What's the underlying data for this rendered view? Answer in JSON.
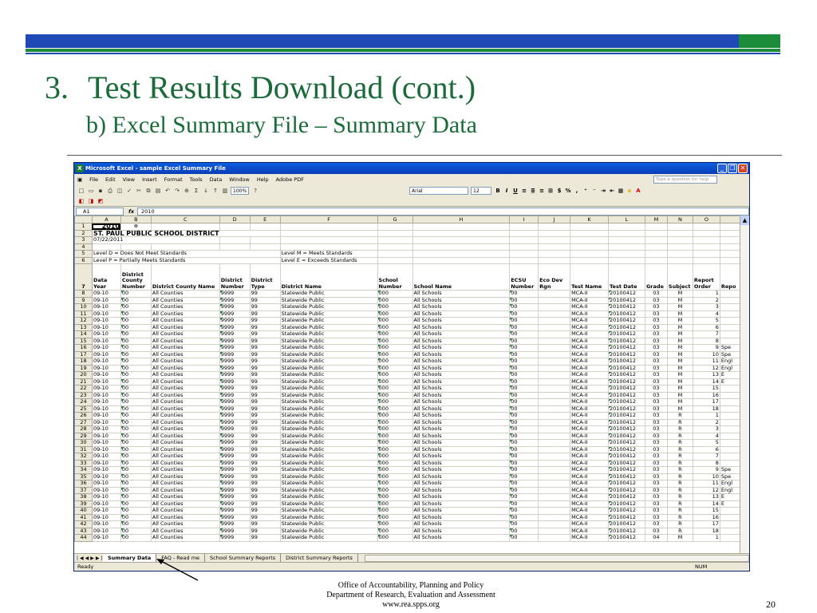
{
  "slide": {
    "number": "3.",
    "title": "Test Results Download (cont.)",
    "subtitle": "b) Excel Summary File – Summary Data",
    "footer_lines": [
      "Office of Accountability, Planning and Policy",
      "Department of Research, Evaluation and Assessment",
      "www.rea.spps.org"
    ],
    "page_number": "20",
    "colors": {
      "title": "#1b6b3a",
      "bar_blue": "#1f49b5",
      "bar_green": "#1d8c3a"
    }
  },
  "excel": {
    "window_title": "Microsoft Excel - sample Excel Summary File",
    "app_icon": "excel-icon",
    "menu": [
      "File",
      "Edit",
      "View",
      "Insert",
      "Format",
      "Tools",
      "Data",
      "Window",
      "Help",
      "Adobe PDF"
    ],
    "help_placeholder": "Type a question for help",
    "font_name": "Arial",
    "font_size": "12",
    "zoom": "100%",
    "name_box": "A1",
    "formula_value": "2010",
    "column_letters": [
      "A",
      "B",
      "C",
      "D",
      "E",
      "F",
      "G",
      "H",
      "I",
      "J",
      "K",
      "L",
      "M",
      "N",
      "O",
      ""
    ],
    "a1_value": "2010",
    "title_row": "ST. PAUL PUBLIC SCHOOL DISTRICT",
    "date_row": "07/22/2011",
    "legend": {
      "d": "Level D = Does Not Meet Standards",
      "p": "Level P = Partially Meets Standards",
      "m": "Level M = Meets Standards",
      "e": "Level E = Exceeds Standards"
    },
    "headers": [
      "Data Year",
      "District County Number",
      "District County Name",
      "District Number",
      "District Type",
      "District Name",
      "School Number",
      "School Name",
      "ECSU Number",
      "Eco Dev Rgn",
      "Test Name",
      "Test Date",
      "Grade",
      "Subject",
      "Report Order",
      "Repo"
    ],
    "rows": [
      [
        "8",
        "09-10",
        "00",
        "All Counties",
        "9999",
        "99",
        "Statewide Public",
        "000",
        "All Schools",
        "00",
        "",
        "MCA-II",
        "20100412",
        "03",
        "M",
        "1",
        ""
      ],
      [
        "9",
        "09-10",
        "00",
        "All Counties",
        "9999",
        "99",
        "Statewide Public",
        "000",
        "All Schools",
        "00",
        "",
        "MCA-II",
        "20100412",
        "03",
        "M",
        "2",
        ""
      ],
      [
        "10",
        "09-10",
        "00",
        "All Counties",
        "9999",
        "99",
        "Statewide Public",
        "000",
        "All Schools",
        "00",
        "",
        "MCA-II",
        "20100412",
        "03",
        "M",
        "3",
        ""
      ],
      [
        "11",
        "09-10",
        "00",
        "All Counties",
        "9999",
        "99",
        "Statewide Public",
        "000",
        "All Schools",
        "00",
        "",
        "MCA-II",
        "20100412",
        "03",
        "M",
        "4",
        ""
      ],
      [
        "12",
        "09-10",
        "00",
        "All Counties",
        "9999",
        "99",
        "Statewide Public",
        "000",
        "All Schools",
        "00",
        "",
        "MCA-II",
        "20100412",
        "03",
        "M",
        "5",
        ""
      ],
      [
        "13",
        "09-10",
        "00",
        "All Counties",
        "9999",
        "99",
        "Statewide Public",
        "000",
        "All Schools",
        "00",
        "",
        "MCA-II",
        "20100412",
        "03",
        "M",
        "6",
        ""
      ],
      [
        "14",
        "09-10",
        "00",
        "All Counties",
        "9999",
        "99",
        "Statewide Public",
        "000",
        "All Schools",
        "00",
        "",
        "MCA-II",
        "20100412",
        "03",
        "M",
        "7",
        ""
      ],
      [
        "15",
        "09-10",
        "00",
        "All Counties",
        "9999",
        "99",
        "Statewide Public",
        "000",
        "All Schools",
        "00",
        "",
        "MCA-II",
        "20100412",
        "03",
        "M",
        "8",
        ""
      ],
      [
        "16",
        "09-10",
        "00",
        "All Counties",
        "9999",
        "99",
        "Statewide Public",
        "000",
        "All Schools",
        "00",
        "",
        "MCA-II",
        "20100412",
        "03",
        "M",
        "9",
        "Spe"
      ],
      [
        "17",
        "09-10",
        "00",
        "All Counties",
        "9999",
        "99",
        "Statewide Public",
        "000",
        "All Schools",
        "00",
        "",
        "MCA-II",
        "20100412",
        "03",
        "M",
        "10",
        "Spe"
      ],
      [
        "18",
        "09-10",
        "00",
        "All Counties",
        "9999",
        "99",
        "Statewide Public",
        "000",
        "All Schools",
        "00",
        "",
        "MCA-II",
        "20100412",
        "03",
        "M",
        "11",
        "Engl"
      ],
      [
        "19",
        "09-10",
        "00",
        "All Counties",
        "9999",
        "99",
        "Statewide Public",
        "000",
        "All Schools",
        "00",
        "",
        "MCA-II",
        "20100412",
        "03",
        "M",
        "12",
        "Engl"
      ],
      [
        "20",
        "09-10",
        "00",
        "All Counties",
        "9999",
        "99",
        "Statewide Public",
        "000",
        "All Schools",
        "00",
        "",
        "MCA-II",
        "20100412",
        "03",
        "M",
        "13",
        "E"
      ],
      [
        "21",
        "09-10",
        "00",
        "All Counties",
        "9999",
        "99",
        "Statewide Public",
        "000",
        "All Schools",
        "00",
        "",
        "MCA-II",
        "20100412",
        "03",
        "M",
        "14",
        "E"
      ],
      [
        "22",
        "09-10",
        "00",
        "All Counties",
        "9999",
        "99",
        "Statewide Public",
        "000",
        "All Schools",
        "00",
        "",
        "MCA-II",
        "20100412",
        "03",
        "M",
        "15",
        ""
      ],
      [
        "23",
        "09-10",
        "00",
        "All Counties",
        "9999",
        "99",
        "Statewide Public",
        "000",
        "All Schools",
        "00",
        "",
        "MCA-II",
        "20100412",
        "03",
        "M",
        "16",
        ""
      ],
      [
        "24",
        "09-10",
        "00",
        "All Counties",
        "9999",
        "99",
        "Statewide Public",
        "000",
        "All Schools",
        "00",
        "",
        "MCA-II",
        "20100412",
        "03",
        "M",
        "17",
        ""
      ],
      [
        "25",
        "09-10",
        "00",
        "All Counties",
        "9999",
        "99",
        "Statewide Public",
        "000",
        "All Schools",
        "00",
        "",
        "MCA-II",
        "20100412",
        "03",
        "M",
        "18",
        ""
      ],
      [
        "26",
        "09-10",
        "00",
        "All Counties",
        "9999",
        "99",
        "Statewide Public",
        "000",
        "All Schools",
        "00",
        "",
        "MCA-II",
        "20100412",
        "03",
        "R",
        "1",
        ""
      ],
      [
        "27",
        "09-10",
        "00",
        "All Counties",
        "9999",
        "99",
        "Statewide Public",
        "000",
        "All Schools",
        "00",
        "",
        "MCA-II",
        "20100412",
        "03",
        "R",
        "2",
        ""
      ],
      [
        "28",
        "09-10",
        "00",
        "All Counties",
        "9999",
        "99",
        "Statewide Public",
        "000",
        "All Schools",
        "00",
        "",
        "MCA-II",
        "20100412",
        "03",
        "R",
        "3",
        ""
      ],
      [
        "29",
        "09-10",
        "00",
        "All Counties",
        "9999",
        "99",
        "Statewide Public",
        "000",
        "All Schools",
        "00",
        "",
        "MCA-II",
        "20100412",
        "03",
        "R",
        "4",
        ""
      ],
      [
        "30",
        "09-10",
        "00",
        "All Counties",
        "9999",
        "99",
        "Statewide Public",
        "000",
        "All Schools",
        "00",
        "",
        "MCA-II",
        "20100412",
        "03",
        "R",
        "5",
        ""
      ],
      [
        "31",
        "09-10",
        "00",
        "All Counties",
        "9999",
        "99",
        "Statewide Public",
        "000",
        "All Schools",
        "00",
        "",
        "MCA-II",
        "20100412",
        "03",
        "R",
        "6",
        ""
      ],
      [
        "32",
        "09-10",
        "00",
        "All Counties",
        "9999",
        "99",
        "Statewide Public",
        "000",
        "All Schools",
        "00",
        "",
        "MCA-II",
        "20100412",
        "03",
        "R",
        "7",
        ""
      ],
      [
        "33",
        "09-10",
        "00",
        "All Counties",
        "9999",
        "99",
        "Statewide Public",
        "000",
        "All Schools",
        "00",
        "",
        "MCA-II",
        "20100412",
        "03",
        "R",
        "8",
        ""
      ],
      [
        "34",
        "09-10",
        "00",
        "All Counties",
        "9999",
        "99",
        "Statewide Public",
        "000",
        "All Schools",
        "00",
        "",
        "MCA-II",
        "20100412",
        "03",
        "R",
        "9",
        "Spe"
      ],
      [
        "35",
        "09-10",
        "00",
        "All Counties",
        "9999",
        "99",
        "Statewide Public",
        "000",
        "All Schools",
        "00",
        "",
        "MCA-II",
        "20100412",
        "03",
        "R",
        "10",
        "Spe"
      ],
      [
        "36",
        "09-10",
        "00",
        "All Counties",
        "9999",
        "99",
        "Statewide Public",
        "000",
        "All Schools",
        "00",
        "",
        "MCA-II",
        "20100412",
        "03",
        "R",
        "11",
        "Engl"
      ],
      [
        "37",
        "09-10",
        "00",
        "All Counties",
        "9999",
        "99",
        "Statewide Public",
        "000",
        "All Schools",
        "00",
        "",
        "MCA-II",
        "20100412",
        "03",
        "R",
        "12",
        "Engl"
      ],
      [
        "38",
        "09-10",
        "00",
        "All Counties",
        "9999",
        "99",
        "Statewide Public",
        "000",
        "All Schools",
        "00",
        "",
        "MCA-II",
        "20100412",
        "03",
        "R",
        "13",
        "E"
      ],
      [
        "39",
        "09-10",
        "00",
        "All Counties",
        "9999",
        "99",
        "Statewide Public",
        "000",
        "All Schools",
        "00",
        "",
        "MCA-II",
        "20100412",
        "03",
        "R",
        "14",
        "E"
      ],
      [
        "40",
        "09-10",
        "00",
        "All Counties",
        "9999",
        "99",
        "Statewide Public",
        "000",
        "All Schools",
        "00",
        "",
        "MCA-II",
        "20100412",
        "03",
        "R",
        "15",
        ""
      ],
      [
        "41",
        "09-10",
        "00",
        "All Counties",
        "9999",
        "99",
        "Statewide Public",
        "000",
        "All Schools",
        "00",
        "",
        "MCA-II",
        "20100412",
        "03",
        "R",
        "16",
        ""
      ],
      [
        "42",
        "09-10",
        "00",
        "All Counties",
        "9999",
        "99",
        "Statewide Public",
        "000",
        "All Schools",
        "00",
        "",
        "MCA-II",
        "20100412",
        "03",
        "R",
        "17",
        ""
      ],
      [
        "43",
        "09-10",
        "00",
        "All Counties",
        "9999",
        "99",
        "Statewide Public",
        "000",
        "All Schools",
        "00",
        "",
        "MCA-II",
        "20100412",
        "03",
        "R",
        "18",
        ""
      ],
      [
        "44",
        "09-10",
        "00",
        "All Counties",
        "9999",
        "99",
        "Statewide Public",
        "000",
        "All Schools",
        "00",
        "",
        "MCA-II",
        "20100412",
        "04",
        "M",
        "1",
        ""
      ]
    ],
    "sheet_tabs": [
      "Summary Data",
      "FAQ - Read me",
      "School Summary Reports",
      "District Summary Reports"
    ],
    "status": "Ready",
    "num_indicator": "NUM"
  }
}
